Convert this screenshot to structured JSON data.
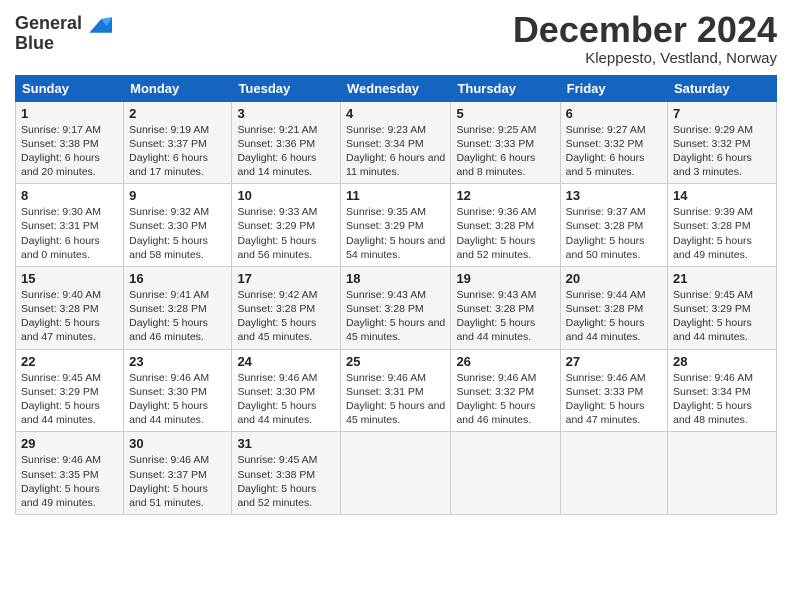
{
  "header": {
    "logo_line1": "General",
    "logo_line2": "Blue",
    "title": "December 2024",
    "subtitle": "Kleppesto, Vestland, Norway"
  },
  "columns": [
    "Sunday",
    "Monday",
    "Tuesday",
    "Wednesday",
    "Thursday",
    "Friday",
    "Saturday"
  ],
  "weeks": [
    [
      {
        "day": "1",
        "sunrise": "Sunrise: 9:17 AM",
        "sunset": "Sunset: 3:38 PM",
        "daylight": "Daylight: 6 hours and 20 minutes."
      },
      {
        "day": "2",
        "sunrise": "Sunrise: 9:19 AM",
        "sunset": "Sunset: 3:37 PM",
        "daylight": "Daylight: 6 hours and 17 minutes."
      },
      {
        "day": "3",
        "sunrise": "Sunrise: 9:21 AM",
        "sunset": "Sunset: 3:36 PM",
        "daylight": "Daylight: 6 hours and 14 minutes."
      },
      {
        "day": "4",
        "sunrise": "Sunrise: 9:23 AM",
        "sunset": "Sunset: 3:34 PM",
        "daylight": "Daylight: 6 hours and 11 minutes."
      },
      {
        "day": "5",
        "sunrise": "Sunrise: 9:25 AM",
        "sunset": "Sunset: 3:33 PM",
        "daylight": "Daylight: 6 hours and 8 minutes."
      },
      {
        "day": "6",
        "sunrise": "Sunrise: 9:27 AM",
        "sunset": "Sunset: 3:32 PM",
        "daylight": "Daylight: 6 hours and 5 minutes."
      },
      {
        "day": "7",
        "sunrise": "Sunrise: 9:29 AM",
        "sunset": "Sunset: 3:32 PM",
        "daylight": "Daylight: 6 hours and 3 minutes."
      }
    ],
    [
      {
        "day": "8",
        "sunrise": "Sunrise: 9:30 AM",
        "sunset": "Sunset: 3:31 PM",
        "daylight": "Daylight: 6 hours and 0 minutes."
      },
      {
        "day": "9",
        "sunrise": "Sunrise: 9:32 AM",
        "sunset": "Sunset: 3:30 PM",
        "daylight": "Daylight: 5 hours and 58 minutes."
      },
      {
        "day": "10",
        "sunrise": "Sunrise: 9:33 AM",
        "sunset": "Sunset: 3:29 PM",
        "daylight": "Daylight: 5 hours and 56 minutes."
      },
      {
        "day": "11",
        "sunrise": "Sunrise: 9:35 AM",
        "sunset": "Sunset: 3:29 PM",
        "daylight": "Daylight: 5 hours and 54 minutes."
      },
      {
        "day": "12",
        "sunrise": "Sunrise: 9:36 AM",
        "sunset": "Sunset: 3:28 PM",
        "daylight": "Daylight: 5 hours and 52 minutes."
      },
      {
        "day": "13",
        "sunrise": "Sunrise: 9:37 AM",
        "sunset": "Sunset: 3:28 PM",
        "daylight": "Daylight: 5 hours and 50 minutes."
      },
      {
        "day": "14",
        "sunrise": "Sunrise: 9:39 AM",
        "sunset": "Sunset: 3:28 PM",
        "daylight": "Daylight: 5 hours and 49 minutes."
      }
    ],
    [
      {
        "day": "15",
        "sunrise": "Sunrise: 9:40 AM",
        "sunset": "Sunset: 3:28 PM",
        "daylight": "Daylight: 5 hours and 47 minutes."
      },
      {
        "day": "16",
        "sunrise": "Sunrise: 9:41 AM",
        "sunset": "Sunset: 3:28 PM",
        "daylight": "Daylight: 5 hours and 46 minutes."
      },
      {
        "day": "17",
        "sunrise": "Sunrise: 9:42 AM",
        "sunset": "Sunset: 3:28 PM",
        "daylight": "Daylight: 5 hours and 45 minutes."
      },
      {
        "day": "18",
        "sunrise": "Sunrise: 9:43 AM",
        "sunset": "Sunset: 3:28 PM",
        "daylight": "Daylight: 5 hours and 45 minutes."
      },
      {
        "day": "19",
        "sunrise": "Sunrise: 9:43 AM",
        "sunset": "Sunset: 3:28 PM",
        "daylight": "Daylight: 5 hours and 44 minutes."
      },
      {
        "day": "20",
        "sunrise": "Sunrise: 9:44 AM",
        "sunset": "Sunset: 3:28 PM",
        "daylight": "Daylight: 5 hours and 44 minutes."
      },
      {
        "day": "21",
        "sunrise": "Sunrise: 9:45 AM",
        "sunset": "Sunset: 3:29 PM",
        "daylight": "Daylight: 5 hours and 44 minutes."
      }
    ],
    [
      {
        "day": "22",
        "sunrise": "Sunrise: 9:45 AM",
        "sunset": "Sunset: 3:29 PM",
        "daylight": "Daylight: 5 hours and 44 minutes."
      },
      {
        "day": "23",
        "sunrise": "Sunrise: 9:46 AM",
        "sunset": "Sunset: 3:30 PM",
        "daylight": "Daylight: 5 hours and 44 minutes."
      },
      {
        "day": "24",
        "sunrise": "Sunrise: 9:46 AM",
        "sunset": "Sunset: 3:30 PM",
        "daylight": "Daylight: 5 hours and 44 minutes."
      },
      {
        "day": "25",
        "sunrise": "Sunrise: 9:46 AM",
        "sunset": "Sunset: 3:31 PM",
        "daylight": "Daylight: 5 hours and 45 minutes."
      },
      {
        "day": "26",
        "sunrise": "Sunrise: 9:46 AM",
        "sunset": "Sunset: 3:32 PM",
        "daylight": "Daylight: 5 hours and 46 minutes."
      },
      {
        "day": "27",
        "sunrise": "Sunrise: 9:46 AM",
        "sunset": "Sunset: 3:33 PM",
        "daylight": "Daylight: 5 hours and 47 minutes."
      },
      {
        "day": "28",
        "sunrise": "Sunrise: 9:46 AM",
        "sunset": "Sunset: 3:34 PM",
        "daylight": "Daylight: 5 hours and 48 minutes."
      }
    ],
    [
      {
        "day": "29",
        "sunrise": "Sunrise: 9:46 AM",
        "sunset": "Sunset: 3:35 PM",
        "daylight": "Daylight: 5 hours and 49 minutes."
      },
      {
        "day": "30",
        "sunrise": "Sunrise: 9:46 AM",
        "sunset": "Sunset: 3:37 PM",
        "daylight": "Daylight: 5 hours and 51 minutes."
      },
      {
        "day": "31",
        "sunrise": "Sunrise: 9:45 AM",
        "sunset": "Sunset: 3:38 PM",
        "daylight": "Daylight: 5 hours and 52 minutes."
      },
      null,
      null,
      null,
      null
    ]
  ]
}
